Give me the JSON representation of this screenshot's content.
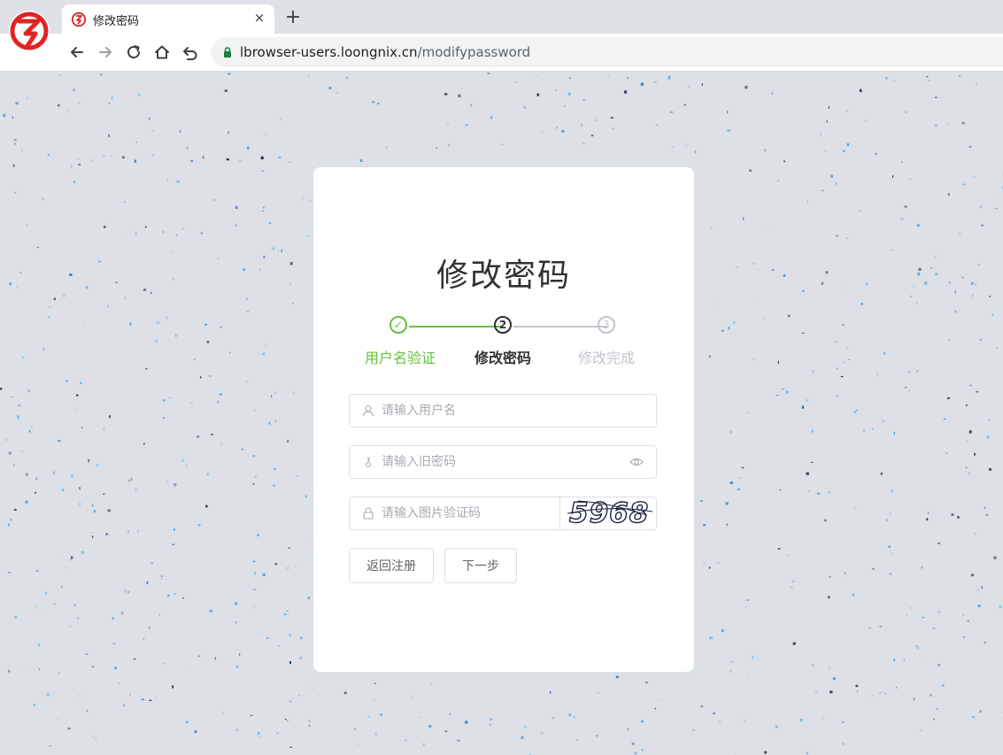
{
  "browser": {
    "logo": "loongnix-browser-logo",
    "tab": {
      "title": "修改密码",
      "favicon": "loongnix-favicon",
      "close_icon": "×"
    },
    "new_tab_icon": "+",
    "url": {
      "host": "lbrowser-users.loongnix.cn",
      "path": "/modifypassword",
      "secure": true
    }
  },
  "page": {
    "title": "修改密码",
    "steps": [
      {
        "label": "用户名验证",
        "marker": "✓",
        "status": "done"
      },
      {
        "label": "修改密码",
        "marker": "2",
        "status": "active"
      },
      {
        "label": "修改完成",
        "marker": "3",
        "status": "pending"
      }
    ],
    "form": {
      "username": {
        "placeholder": "请输入用户名",
        "value": ""
      },
      "old_password": {
        "placeholder": "请输入旧密码",
        "value": ""
      },
      "captcha_input": {
        "placeholder": "请输入图片验证码",
        "value": ""
      },
      "captcha_image_text": "5968"
    },
    "buttons": {
      "back": "返回注册",
      "next": "下一步"
    }
  },
  "colors": {
    "success": "#67c23a",
    "active": "#303133",
    "pending": "#c0c4cc",
    "page_bg": "#dde0e5",
    "brand_red": "#e02424"
  }
}
